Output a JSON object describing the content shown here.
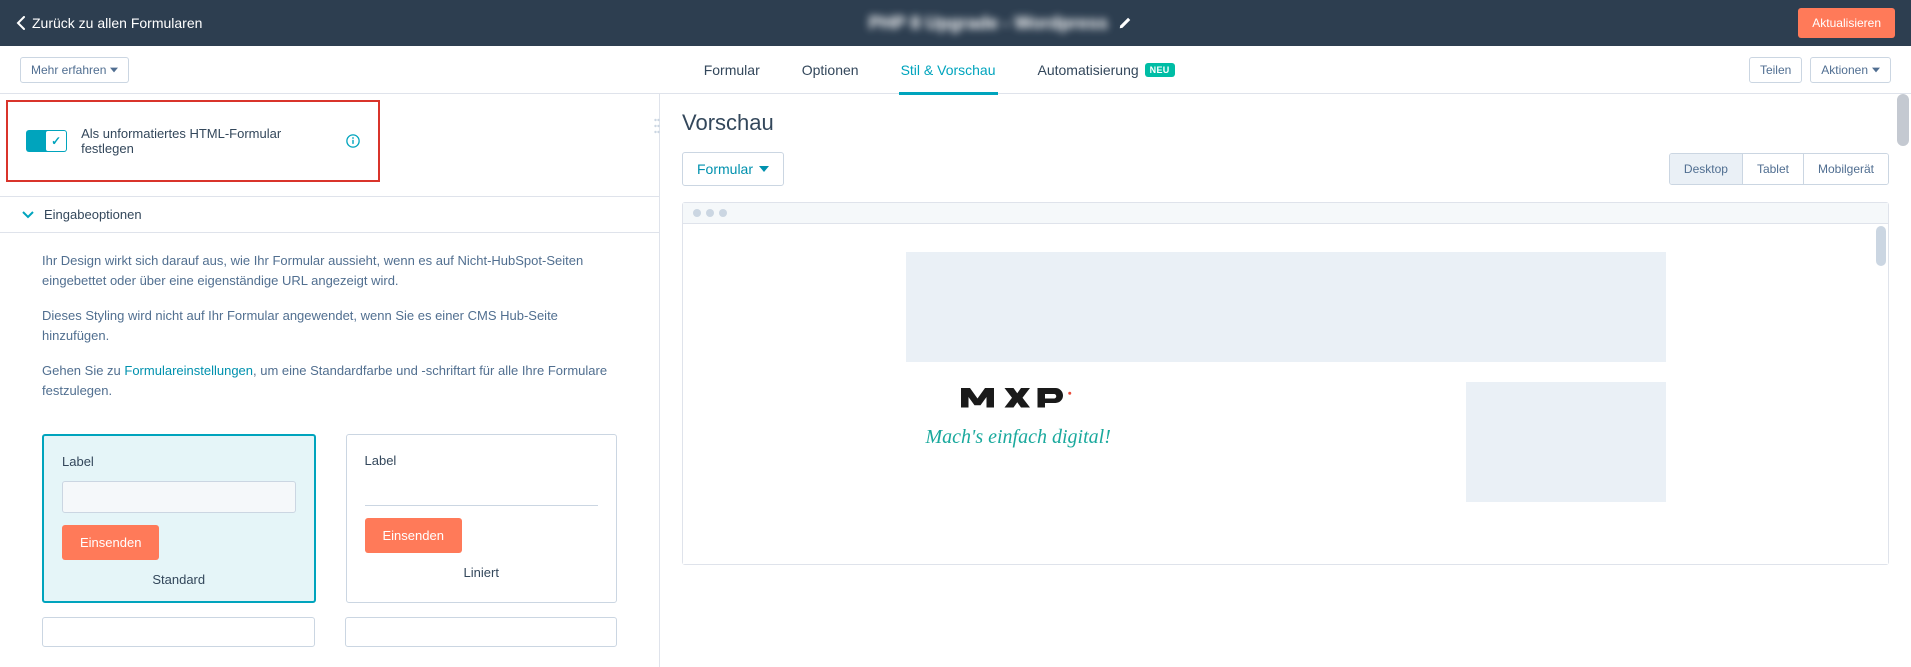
{
  "topbar": {
    "back_label": "Zurück zu allen Formularen",
    "page_title": "PHP 8 Upgrade - Wordpress",
    "update_label": "Aktualisieren"
  },
  "tabbar": {
    "more_label": "Mehr erfahren",
    "tabs": {
      "form": "Formular",
      "options": "Optionen",
      "style": "Stil & Vorschau",
      "automation": "Automatisierung",
      "badge": "NEU"
    },
    "share": "Teilen",
    "actions": "Aktionen"
  },
  "raw_html": {
    "label": "Als unformatiertes HTML-Formular festlegen"
  },
  "accordion": {
    "input_options": "Eingabeoptionen"
  },
  "body": {
    "p1": "Ihr Design wirkt sich darauf aus, wie Ihr Formular aussieht, wenn es auf Nicht-HubSpot-Seiten eingebettet oder über eine eigenständige URL angezeigt wird.",
    "p2": "Dieses Styling wird nicht auf Ihr Formular angewendet, wenn Sie es einer CMS Hub-Seite hinzufügen.",
    "p3_pre": "Gehen Sie zu ",
    "p3_link": "Formulareinstellungen",
    "p3_post": ", um eine Standardfarbe und -schriftart für alle Ihre Formulare festzulegen."
  },
  "cards": {
    "label": "Label",
    "submit": "Einsenden",
    "standard": "Standard",
    "linear": "Liniert"
  },
  "preview": {
    "title": "Vorschau",
    "select": "Formular",
    "devices": {
      "desktop": "Desktop",
      "tablet": "Tablet",
      "mobile": "Mobilgerät"
    },
    "logo": "mxp",
    "tagline": "Mach's einfach digital!"
  }
}
